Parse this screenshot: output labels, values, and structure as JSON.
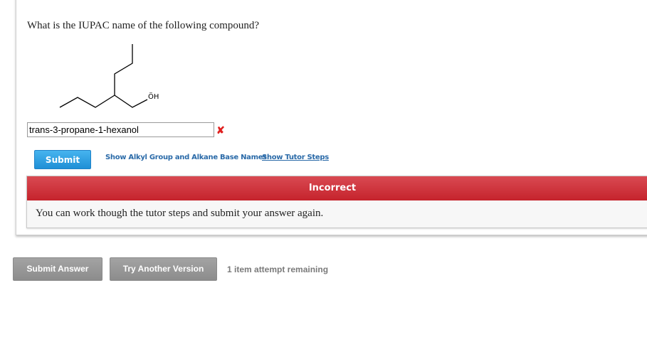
{
  "question": {
    "text": "What is the IUPAC name of the following compound?"
  },
  "molecule": {
    "oh_label": "ÖH"
  },
  "answer": {
    "value": "trans-3-propane-1-hexanol",
    "status_icon": "x-icon",
    "status_color": "#e0201f"
  },
  "controls": {
    "submit_label": "Submit",
    "alkyl_link": "Show Alkyl Group and Alkane Base Names",
    "tutor_link": "Show Tutor Steps"
  },
  "feedback": {
    "header": "Incorrect",
    "message": "You can work though the tutor steps and submit your answer again.",
    "header_color": "#c9262f"
  },
  "footer": {
    "submit_answer_label": "Submit Answer",
    "try_another_label": "Try Another Version",
    "attempts_text": "1 item attempt remaining"
  }
}
